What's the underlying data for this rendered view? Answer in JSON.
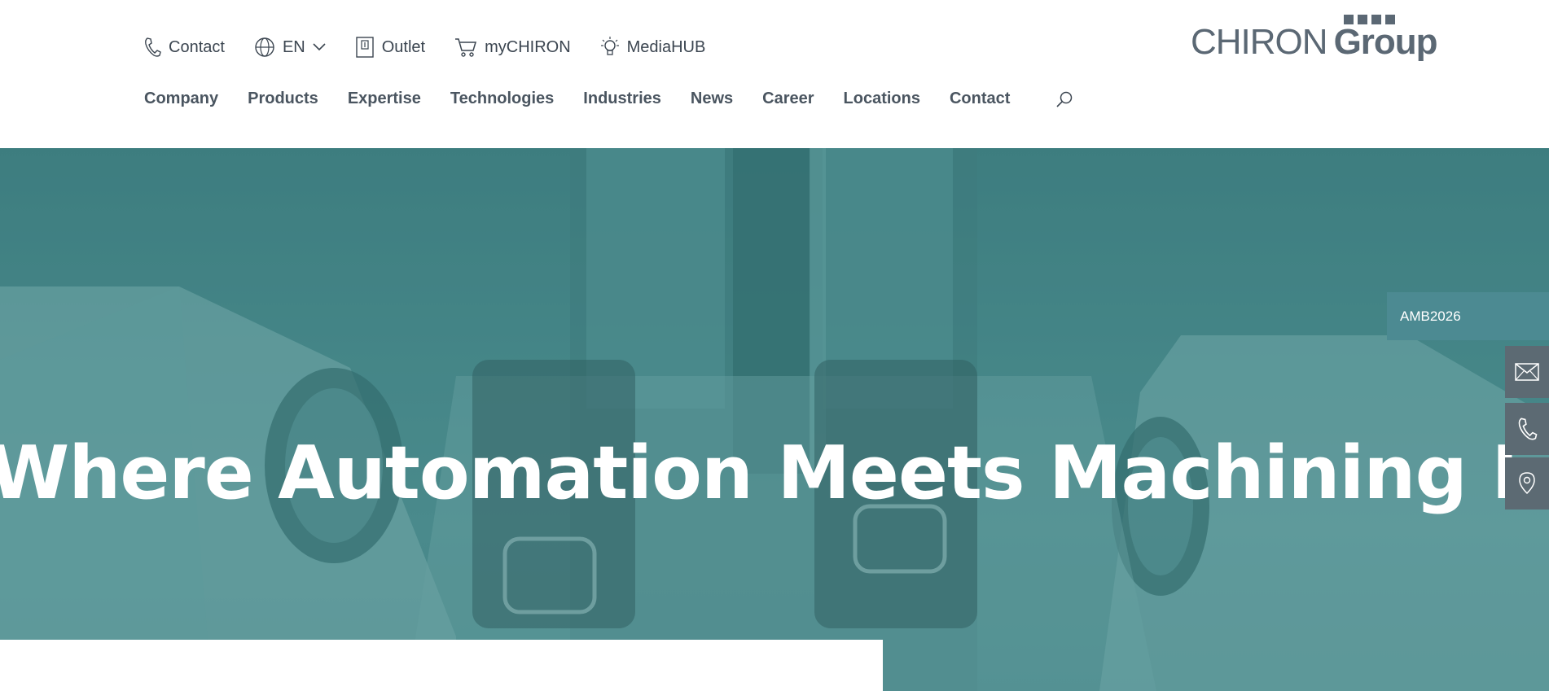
{
  "utility": {
    "contact": "Contact",
    "language": "EN",
    "outlet": "Outlet",
    "mychiron": "myCHIRON",
    "mediahub": "MediaHUB"
  },
  "logo": {
    "primary": "CHIRON",
    "secondary": "Group"
  },
  "nav": {
    "items": [
      "Company",
      "Products",
      "Expertise",
      "Technologies",
      "Industries",
      "News",
      "Career",
      "Locations",
      "Contact"
    ]
  },
  "hero": {
    "title": "Where Automation Meets Machining Excellence"
  },
  "side": {
    "event_label": "AMB2026",
    "buttons": [
      "mail-icon",
      "phone-icon",
      "location-pin-icon"
    ]
  },
  "colors": {
    "text": "#3b4550",
    "logo": "#5b6874",
    "hero_teal": "#4a8788",
    "event_tab": "#4c8a92",
    "side_button": "#5c6a73"
  }
}
